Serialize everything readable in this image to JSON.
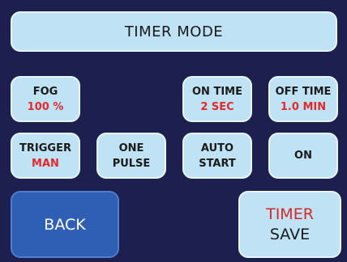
{
  "title": "TIMER MODE",
  "fog": {
    "label": "FOG",
    "value": "100 %"
  },
  "on_time": {
    "label": "ON TIME",
    "value": "2 SEC"
  },
  "off_time": {
    "label": "OFF TIME",
    "value": "1.0 MIN"
  },
  "trigger": {
    "label": "TRIGGER",
    "value": "MAN"
  },
  "one_pulse": {
    "line1": "ONE",
    "line2": "PULSE"
  },
  "auto_start": {
    "line1": "AUTO",
    "line2": "START"
  },
  "on_button": {
    "label": "ON"
  },
  "back": {
    "label": "BACK"
  },
  "timer_save": {
    "line1": "TIMER",
    "line2": "SAVE"
  },
  "colors": {
    "background": "#1d1f4e",
    "button": "#bfe3f5",
    "value_red": "#e32a2a",
    "back_button": "#2f5fb5"
  }
}
